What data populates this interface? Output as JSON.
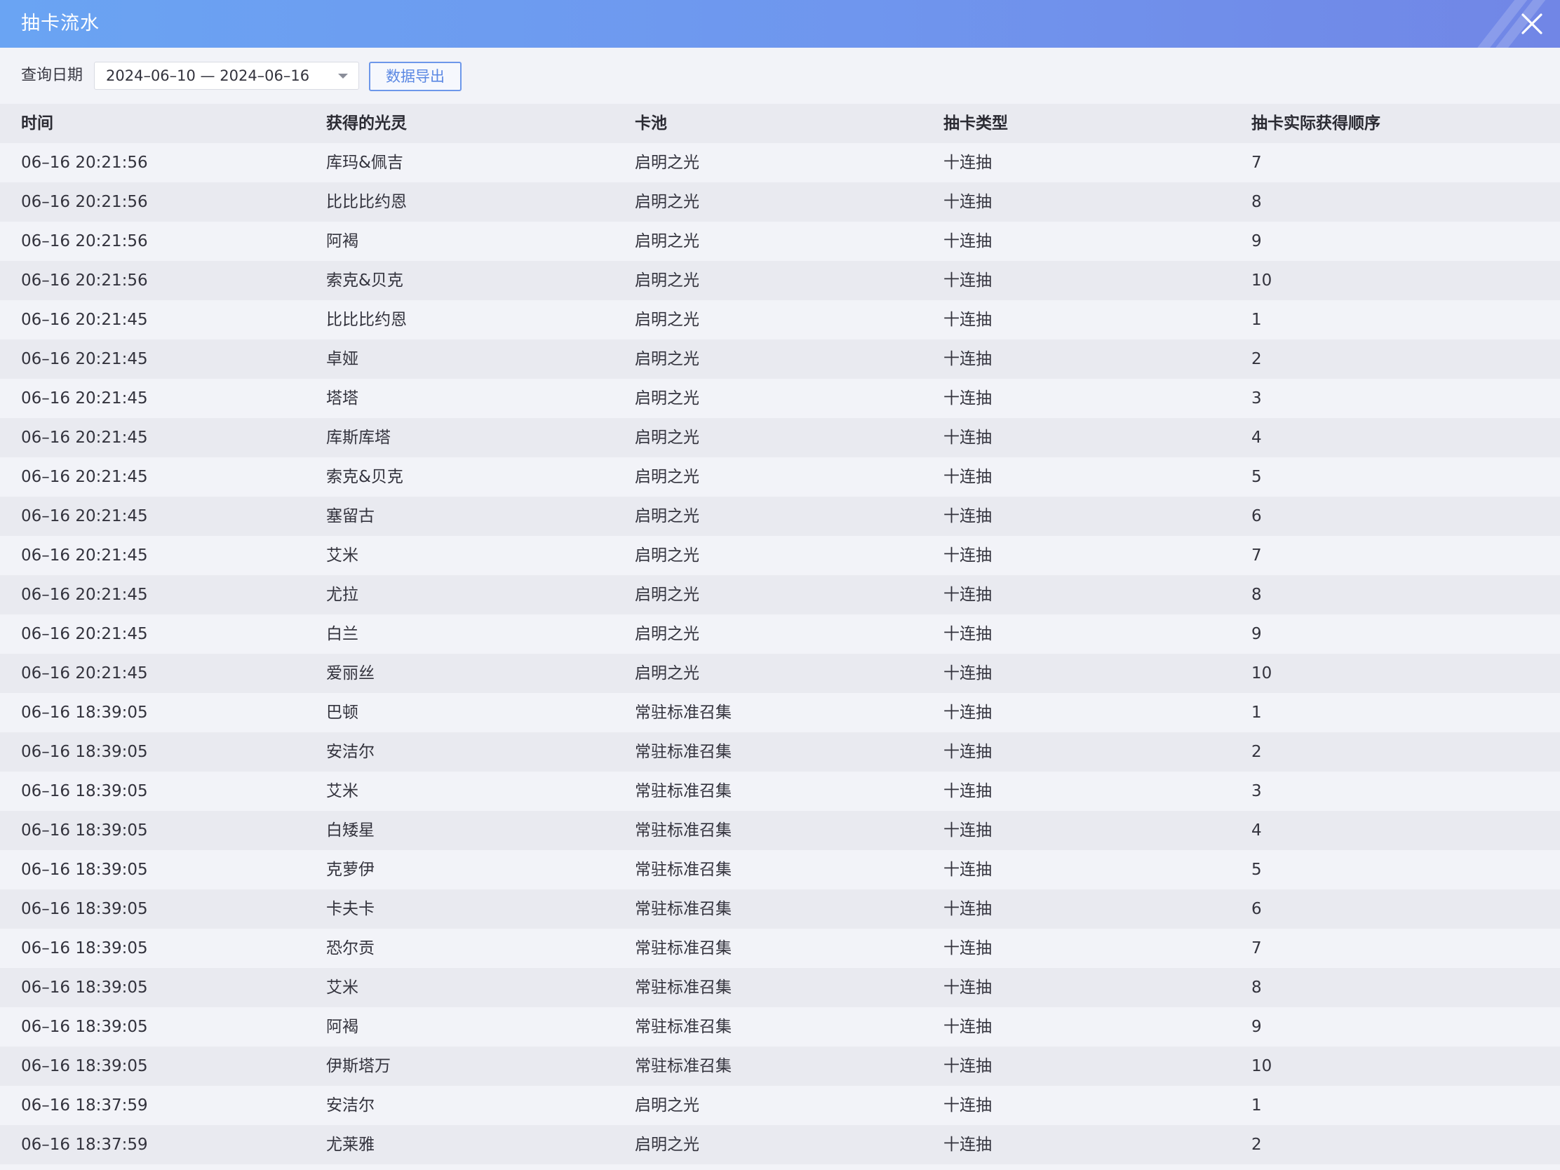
{
  "window": {
    "title": "抽卡流水",
    "accent_color": "#6f96ee",
    "close_icon": "close-icon"
  },
  "toolbar": {
    "date_label": "查询日期",
    "date_range": "2024–06–10 — 2024–06–16",
    "export_label": "数据导出"
  },
  "table": {
    "headers": [
      "时间",
      "获得的光灵",
      "卡池",
      "抽卡类型",
      "抽卡实际获得顺序"
    ],
    "rows": [
      {
        "time": "06–16 20:21:56",
        "spirit": "库玛&佩吉",
        "pool": "启明之光",
        "type": "十连抽",
        "order": "7"
      },
      {
        "time": "06–16 20:21:56",
        "spirit": "比比比约恩",
        "pool": "启明之光",
        "type": "十连抽",
        "order": "8"
      },
      {
        "time": "06–16 20:21:56",
        "spirit": "阿褐",
        "pool": "启明之光",
        "type": "十连抽",
        "order": "9"
      },
      {
        "time": "06–16 20:21:56",
        "spirit": "索克&贝克",
        "pool": "启明之光",
        "type": "十连抽",
        "order": "10"
      },
      {
        "time": "06–16 20:21:45",
        "spirit": "比比比约恩",
        "pool": "启明之光",
        "type": "十连抽",
        "order": "1"
      },
      {
        "time": "06–16 20:21:45",
        "spirit": "卓娅",
        "pool": "启明之光",
        "type": "十连抽",
        "order": "2"
      },
      {
        "time": "06–16 20:21:45",
        "spirit": "塔塔",
        "pool": "启明之光",
        "type": "十连抽",
        "order": "3"
      },
      {
        "time": "06–16 20:21:45",
        "spirit": "库斯库塔",
        "pool": "启明之光",
        "type": "十连抽",
        "order": "4"
      },
      {
        "time": "06–16 20:21:45",
        "spirit": "索克&贝克",
        "pool": "启明之光",
        "type": "十连抽",
        "order": "5"
      },
      {
        "time": "06–16 20:21:45",
        "spirit": "塞留古",
        "pool": "启明之光",
        "type": "十连抽",
        "order": "6"
      },
      {
        "time": "06–16 20:21:45",
        "spirit": "艾米",
        "pool": "启明之光",
        "type": "十连抽",
        "order": "7"
      },
      {
        "time": "06–16 20:21:45",
        "spirit": "尤拉",
        "pool": "启明之光",
        "type": "十连抽",
        "order": "8"
      },
      {
        "time": "06–16 20:21:45",
        "spirit": "白兰",
        "pool": "启明之光",
        "type": "十连抽",
        "order": "9"
      },
      {
        "time": "06–16 20:21:45",
        "spirit": "爱丽丝",
        "pool": "启明之光",
        "type": "十连抽",
        "order": "10"
      },
      {
        "time": "06–16 18:39:05",
        "spirit": "巴顿",
        "pool": "常驻标准召集",
        "type": "十连抽",
        "order": "1"
      },
      {
        "time": "06–16 18:39:05",
        "spirit": "安洁尔",
        "pool": "常驻标准召集",
        "type": "十连抽",
        "order": "2"
      },
      {
        "time": "06–16 18:39:05",
        "spirit": "艾米",
        "pool": "常驻标准召集",
        "type": "十连抽",
        "order": "3"
      },
      {
        "time": "06–16 18:39:05",
        "spirit": "白矮星",
        "pool": "常驻标准召集",
        "type": "十连抽",
        "order": "4"
      },
      {
        "time": "06–16 18:39:05",
        "spirit": "克萝伊",
        "pool": "常驻标准召集",
        "type": "十连抽",
        "order": "5"
      },
      {
        "time": "06–16 18:39:05",
        "spirit": "卡夫卡",
        "pool": "常驻标准召集",
        "type": "十连抽",
        "order": "6"
      },
      {
        "time": "06–16 18:39:05",
        "spirit": "恐尔贡",
        "pool": "常驻标准召集",
        "type": "十连抽",
        "order": "7"
      },
      {
        "time": "06–16 18:39:05",
        "spirit": "艾米",
        "pool": "常驻标准召集",
        "type": "十连抽",
        "order": "8"
      },
      {
        "time": "06–16 18:39:05",
        "spirit": "阿褐",
        "pool": "常驻标准召集",
        "type": "十连抽",
        "order": "9"
      },
      {
        "time": "06–16 18:39:05",
        "spirit": "伊斯塔万",
        "pool": "常驻标准召集",
        "type": "十连抽",
        "order": "10"
      },
      {
        "time": "06–16 18:37:59",
        "spirit": "安洁尔",
        "pool": "启明之光",
        "type": "十连抽",
        "order": "1"
      },
      {
        "time": "06–16 18:37:59",
        "spirit": "尤莱雅",
        "pool": "启明之光",
        "type": "十连抽",
        "order": "2"
      }
    ]
  }
}
